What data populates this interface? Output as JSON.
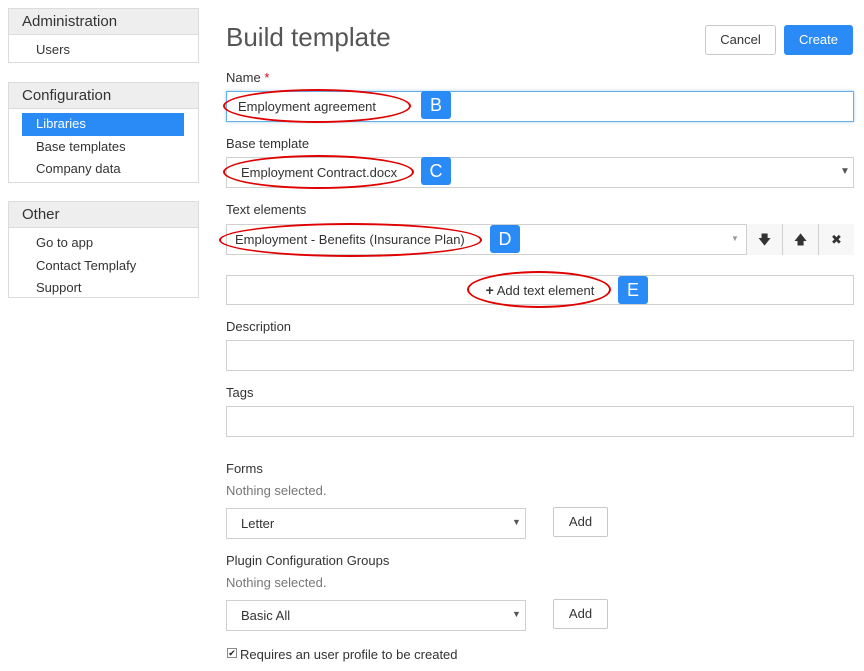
{
  "sidebar": {
    "administration": {
      "title": "Administration",
      "items": [
        "Users"
      ]
    },
    "configuration": {
      "title": "Configuration",
      "items": [
        "Libraries",
        "Base templates",
        "Company data"
      ],
      "active": "Libraries"
    },
    "other": {
      "title": "Other",
      "items": [
        "Go to app",
        "Contact Templafy",
        "Support"
      ]
    }
  },
  "page": {
    "title": "Build template",
    "cancel_label": "Cancel",
    "create_label": "Create"
  },
  "name": {
    "label": "Name",
    "required_mark": "*",
    "value": "Employment agreement",
    "marker": "B"
  },
  "base_template": {
    "label": "Base template",
    "value": "Employment Contract.docx",
    "marker": "C"
  },
  "text_elements": {
    "label": "Text elements",
    "value": "Employment - Benefits (Insurance Plan)",
    "marker": "D",
    "down_icon": "arrow-down-icon",
    "up_icon": "arrow-up-icon",
    "remove_icon": "close-icon",
    "add_label": "Add text element",
    "add_marker": "E"
  },
  "description": {
    "label": "Description",
    "value": ""
  },
  "tags": {
    "label": "Tags",
    "value": ""
  },
  "forms": {
    "label": "Forms",
    "status": "Nothing selected.",
    "selected": "Letter",
    "add_label": "Add"
  },
  "plugin_groups": {
    "label": "Plugin Configuration Groups",
    "status": "Nothing selected.",
    "selected": "Basic All",
    "add_label": "Add"
  },
  "user_profile": {
    "label": "Requires an user profile to be created",
    "checked": true
  },
  "colors": {
    "accent": "#2a8af6",
    "annotation": "#e00000"
  }
}
